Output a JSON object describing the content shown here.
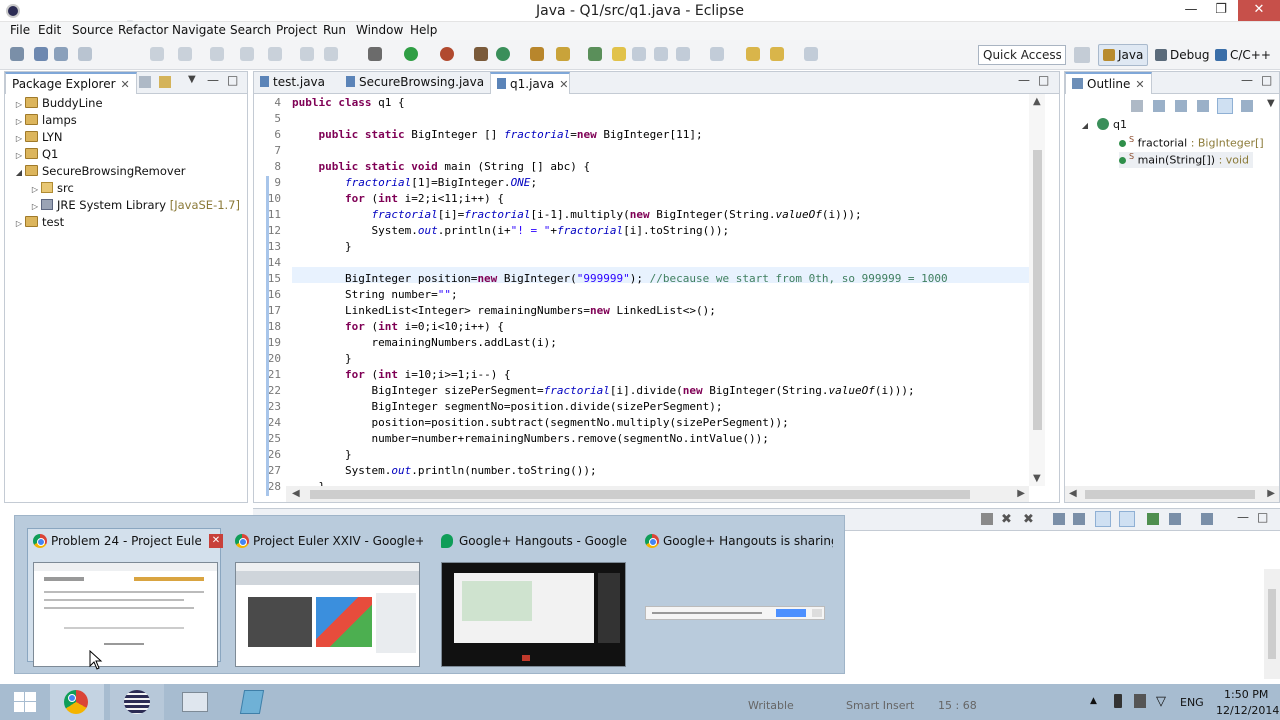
{
  "window": {
    "title": "Java - Q1/src/q1.java - Eclipse"
  },
  "watermark": "Google+",
  "menu": [
    "File",
    "Edit",
    "Source",
    "Refactor",
    "Navigate",
    "Search",
    "Project",
    "Run",
    "Window",
    "Help"
  ],
  "toolbar": {
    "quick_access": "Quick Access"
  },
  "perspectives": [
    {
      "label": "Java",
      "active": true
    },
    {
      "label": "Debug",
      "active": false
    },
    {
      "label": "C/C++",
      "active": false
    }
  ],
  "package_explorer": {
    "title": "Package Explorer",
    "items": [
      {
        "label": "BuddyLine",
        "kind": "project",
        "indent": 0,
        "expanded": false
      },
      {
        "label": "lamps",
        "kind": "project",
        "indent": 0,
        "expanded": false
      },
      {
        "label": "LYN",
        "kind": "project",
        "indent": 0,
        "expanded": false
      },
      {
        "label": "Q1",
        "kind": "project",
        "indent": 0,
        "expanded": false
      },
      {
        "label": "SecureBrowsingRemover",
        "kind": "project",
        "indent": 0,
        "expanded": true
      },
      {
        "label": "src",
        "kind": "package",
        "indent": 1,
        "expanded": false
      },
      {
        "label": "JRE System Library",
        "suffix": "[JavaSE-1.7]",
        "kind": "library",
        "indent": 1,
        "expanded": false
      },
      {
        "label": "test",
        "kind": "project",
        "indent": 0,
        "expanded": false
      }
    ]
  },
  "editor": {
    "tabs": [
      {
        "label": "test.java",
        "active": false
      },
      {
        "label": "SecureBrowsing.java",
        "active": false
      },
      {
        "label": "q1.java",
        "active": true
      }
    ],
    "current_line": 15,
    "lines": [
      {
        "no": "4",
        "text": "public class q1 {"
      },
      {
        "no": "5",
        "text": ""
      },
      {
        "no": "6",
        "text": "    public static BigInteger [] fractorial=new BigInteger[11];"
      },
      {
        "no": "7",
        "text": ""
      },
      {
        "no": "8",
        "text": "    public static void main (String [] abc) {"
      },
      {
        "no": "9",
        "text": "        fractorial[1]=BigInteger.ONE;"
      },
      {
        "no": "10",
        "text": "        for (int i=2;i<11;i++) {"
      },
      {
        "no": "11",
        "text": "            fractorial[i]=fractorial[i-1].multiply(new BigInteger(String.valueOf(i)));"
      },
      {
        "no": "12",
        "text": "            System.out.println(i+\"! = \"+fractorial[i].toString());"
      },
      {
        "no": "13",
        "text": "        }"
      },
      {
        "no": "14",
        "text": ""
      },
      {
        "no": "15",
        "text": "        BigInteger position=new BigInteger(\"999999\"); //because we start from 0th, so 999999 = 1000"
      },
      {
        "no": "16",
        "text": "        String number=\"\";"
      },
      {
        "no": "17",
        "text": "        LinkedList<Integer> remainingNumbers=new LinkedList<>();"
      },
      {
        "no": "18",
        "text": "        for (int i=0;i<10;i++) {"
      },
      {
        "no": "19",
        "text": "            remainingNumbers.addLast(i);"
      },
      {
        "no": "20",
        "text": "        }"
      },
      {
        "no": "21",
        "text": "        for (int i=10;i>=1;i--) {"
      },
      {
        "no": "22",
        "text": "            BigInteger sizePerSegment=fractorial[i].divide(new BigInteger(String.valueOf(i)));"
      },
      {
        "no": "23",
        "text": "            BigInteger segmentNo=position.divide(sizePerSegment);"
      },
      {
        "no": "24",
        "text": "            position=position.subtract(segmentNo.multiply(sizePerSegment));"
      },
      {
        "no": "25",
        "text": "            number=number+remainingNumbers.remove(segmentNo.intValue());"
      },
      {
        "no": "26",
        "text": "        }"
      },
      {
        "no": "27",
        "text": "        System.out.println(number.toString());"
      },
      {
        "no": "28",
        "text": "    }"
      }
    ]
  },
  "outline": {
    "title": "Outline",
    "root": "q1",
    "members": [
      {
        "name": "fractorial",
        "type": ": BigInteger[]",
        "static": "S"
      },
      {
        "name": "main(String[])",
        "type": ": void",
        "static": "S"
      }
    ]
  },
  "taskbar_thumbnails": [
    {
      "title": "Problem 24 - Project Euler - ...",
      "app": "chrome",
      "closable": true
    },
    {
      "title": "Project Euler XXIV - Google+ - G...",
      "app": "chrome",
      "closable": false
    },
    {
      "title": "Google+ Hangouts - Google Ch...",
      "app": "hangouts",
      "closable": false
    },
    {
      "title": "Google+ Hangouts is sharing y...",
      "app": "chrome",
      "closable": false
    }
  ],
  "status_bar": {
    "mode": "Writable",
    "insert": "Smart Insert",
    "position": "15 : 68"
  },
  "tray": {
    "lang": "ENG",
    "time": "1:50 PM",
    "date": "12/12/2014"
  }
}
